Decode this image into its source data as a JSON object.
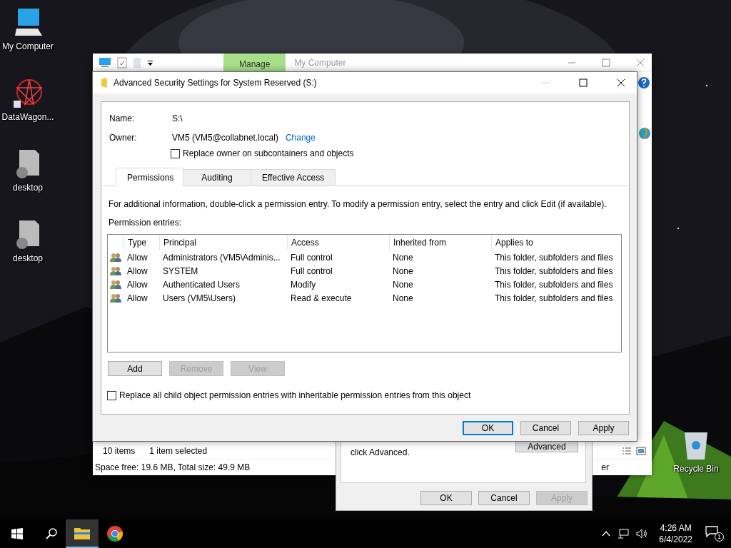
{
  "desktop_icons": [
    {
      "label": "My Computer",
      "kind": "computer"
    },
    {
      "label": "DataWagon...",
      "kind": "app"
    },
    {
      "label": "desktop",
      "kind": "file"
    },
    {
      "label": "desktop",
      "kind": "file"
    }
  ],
  "recycle_bin": {
    "label": "Recycle Bin"
  },
  "explorer": {
    "ribbon_tab": "Manage",
    "title": "My Computer",
    "item_count": "10 items",
    "selection": "1 item selected",
    "space": "Space free: 19.6 MB, Total size: 49.9 MB",
    "status_fragment": "er"
  },
  "properties_dialog": {
    "text": "click Advanced.",
    "advanced_button": "Advanced",
    "buttons": [
      {
        "label": "OK",
        "disabled": false
      },
      {
        "label": "Cancel",
        "disabled": false
      },
      {
        "label": "Apply",
        "disabled": true
      }
    ]
  },
  "dialog": {
    "title": "Advanced Security Settings for System Reserved (S:)",
    "name_label": "Name:",
    "name_value": "S:\\",
    "owner_label": "Owner:",
    "owner_value": "VM5 (VM5@collabnet.local)",
    "change_link": "Change",
    "replace_owner": {
      "label": "Replace owner on subcontainers and objects",
      "checked": false
    },
    "tabs": [
      {
        "label": "Permissions",
        "selected": true
      },
      {
        "label": "Auditing",
        "selected": false
      },
      {
        "label": "Effective Access",
        "selected": false
      }
    ],
    "info": "For additional information, double-click a permission entry. To modify a permission entry, select the entry and click Edit (if available).",
    "entries_label": "Permission entries:",
    "columns": [
      "Type",
      "Principal",
      "Access",
      "Inherited from",
      "Applies to"
    ],
    "rows": [
      {
        "type": "Allow",
        "principal": "Administrators (VM5\\Adminis...",
        "access": "Full control",
        "inherited": "None",
        "applies": "This folder, subfolders and files"
      },
      {
        "type": "Allow",
        "principal": "SYSTEM",
        "access": "Full control",
        "inherited": "None",
        "applies": "This folder, subfolders and files"
      },
      {
        "type": "Allow",
        "principal": "Authenticated Users",
        "access": "Modify",
        "inherited": "None",
        "applies": "This folder, subfolders and files"
      },
      {
        "type": "Allow",
        "principal": "Users (VM5\\Users)",
        "access": "Read & execute",
        "inherited": "None",
        "applies": "This folder, subfolders and files"
      }
    ],
    "actions": [
      {
        "label": "Add",
        "disabled": false
      },
      {
        "label": "Remove",
        "disabled": true
      },
      {
        "label": "View",
        "disabled": true
      }
    ],
    "replace_child": {
      "label": "Replace all child object permission entries with inheritable permission entries from this object",
      "checked": false
    },
    "buttons": [
      {
        "label": "OK",
        "default": true
      },
      {
        "label": "Cancel",
        "default": false
      },
      {
        "label": "Apply",
        "default": false
      }
    ]
  },
  "taskbar": {
    "apps": [
      {
        "kind": "explorer",
        "selected": true
      },
      {
        "kind": "chrome",
        "selected": false
      }
    ],
    "time": "4:26 AM",
    "date": "6/4/2022",
    "notification_count": "1"
  }
}
